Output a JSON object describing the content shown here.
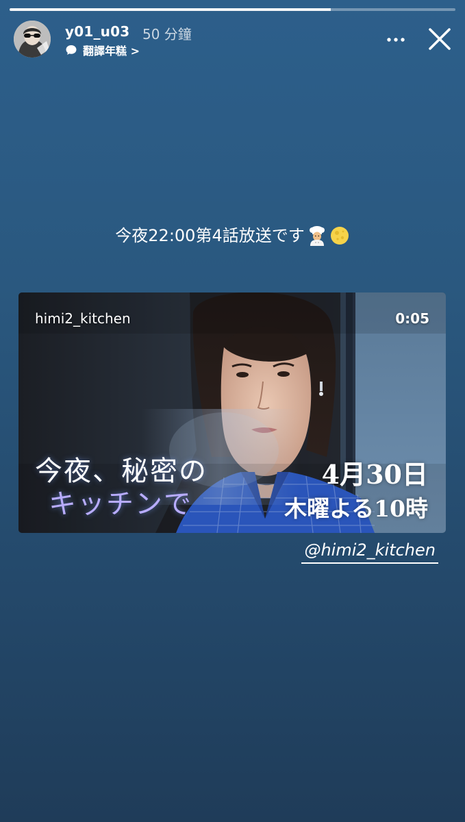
{
  "story": {
    "progress_fraction": 0.72,
    "header": {
      "username": "y01_u03",
      "time_ago": "50 分鐘",
      "translate_label": "翻譯年糕 >",
      "more_icon": "more-horizontal-icon",
      "close_icon": "close-icon"
    },
    "caption": {
      "text": "今夜22:00第4話放送です",
      "emojis": [
        "chef-emoji",
        "moon-emoji"
      ]
    },
    "video": {
      "account": "himi2_kitchen",
      "duration": "0:05",
      "title_line1": "今夜、秘密の",
      "title_line2": "キッチンで",
      "date": "4月30日",
      "airtime": "木曜よる10時"
    },
    "mention": "@himi2_kitchen",
    "colors": {
      "background_top": "#2d5f8b",
      "background_bottom": "#1f3c59",
      "title_accent": "#b8acff",
      "shirt_blue": "#2f5fd0"
    }
  }
}
